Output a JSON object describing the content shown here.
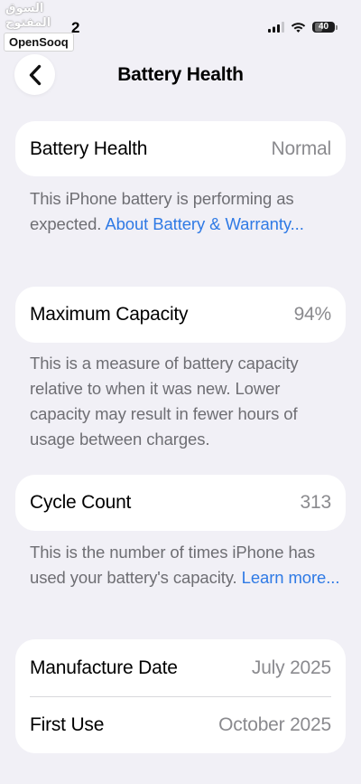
{
  "status_bar": {
    "watermark_arabic": "السوق المفتوح",
    "watermark_brand": "OpenSooq",
    "time_fragment": "2",
    "battery_percent": "40",
    "battery_level": 0.4
  },
  "nav": {
    "back_icon": "chevron-left-icon",
    "title": "Battery Health"
  },
  "battery_health": {
    "label": "Battery Health",
    "value": "Normal",
    "description": "This iPhone battery is performing as expected. ",
    "link": "About Battery & Warranty..."
  },
  "maximum_capacity": {
    "label": "Maximum Capacity",
    "value": "94%",
    "description": "This is a measure of battery capacity relative to when it was new. Lower capacity may result in fewer hours of usage between charges."
  },
  "cycle_count": {
    "label": "Cycle Count",
    "value": "313",
    "description": "This is the number of times iPhone has used your battery's capacity. ",
    "link": "Learn more..."
  },
  "dates": {
    "manufacture_label": "Manufacture Date",
    "manufacture_value": "July 2025",
    "first_use_label": "First Use",
    "first_use_value": "October 2025"
  },
  "colors": {
    "background": "#f1f0f6",
    "card": "#ffffff",
    "link": "#2f7ae5",
    "secondary_text": "#6e6e73",
    "value_text": "#8a8a8e"
  }
}
